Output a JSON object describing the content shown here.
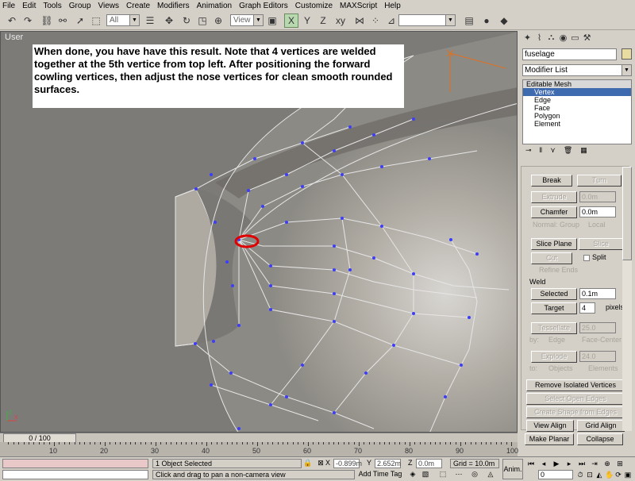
{
  "menu": [
    "File",
    "Edit",
    "Tools",
    "Group",
    "Views",
    "Create",
    "Modifiers",
    "Animation",
    "Graph Editors",
    "Customize",
    "MAXScript",
    "Help"
  ],
  "toolbar": {
    "selection_filter": "All",
    "ref_coord": "View",
    "named_selection": "",
    "icons": [
      "undo-icon",
      "redo-icon",
      "link-icon",
      "unlink-icon",
      "bind-space-warp-icon",
      "select-icon",
      "region-select-icon",
      "select-by-name-icon",
      "move-icon",
      "rotate-icon",
      "scale-icon",
      "mirror-icon",
      "snap-icon",
      "angle-snap-icon",
      "percent-snap-icon",
      "spinner-snap-icon",
      "align-icon",
      "render-icon",
      "material-editor-icon"
    ]
  },
  "viewport": {
    "label": "User",
    "note": "When done, you have have this result.  Note that 4 vertices are welded together at the 5th vertice from top left.  After positioning the forward cowling vertices, then adjust the nose vertices for clean smooth rounded surfaces.",
    "axis_labels": [
      "X",
      "Z"
    ]
  },
  "command_panel": {
    "object_name": "fuselage",
    "modifier_list": "Modifier List",
    "stack": [
      {
        "label": "Editable Mesh",
        "state": "top"
      },
      {
        "label": "Vertex",
        "state": "selected"
      },
      {
        "label": "Edge",
        "state": "normal"
      },
      {
        "label": "Face",
        "state": "normal"
      },
      {
        "label": "Polygon",
        "state": "normal"
      },
      {
        "label": "Element",
        "state": "normal"
      }
    ],
    "buttons": {
      "break": "Break",
      "turn": "Turn",
      "extrude": "Extrude",
      "extrude_val": "0.0m",
      "chamfer": "Chamfer",
      "chamfer_val": "0.0m",
      "normal_label": "Normal:",
      "group_label": "Group",
      "local_label": "Local",
      "slice_plane": "Slice Plane",
      "slice": "Slice",
      "cut": "Cut",
      "split": "Split",
      "refine_ends": "Refine Ends",
      "weld_title": "Weld",
      "selected": "Selected",
      "selected_val": "0.1m",
      "target": "Target",
      "target_val": "4",
      "pixels": "pixels",
      "tessellate": "Tessellate",
      "tess_val": "25.0",
      "by_label": "by:",
      "edge_label": "Edge",
      "face_center": "Face-Center",
      "explode": "Explode",
      "explode_val": "24.0",
      "to_label": "to:",
      "objects": "Objects",
      "elements": "Elements",
      "remove_isolated": "Remove Isolated Vertices",
      "select_open_edges": "Select Open Edges",
      "create_shape": "Create Shape from Edges",
      "view_align": "View Align",
      "grid_align": "Grid Align",
      "make_planar": "Make Planar",
      "collapse": "Collapse"
    }
  },
  "timeline": {
    "slider": "0 / 100",
    "ticks": [
      "10",
      "20",
      "30",
      "40",
      "50",
      "60",
      "70",
      "80",
      "90",
      "100"
    ]
  },
  "status": {
    "selection_info": "1 Object Selected",
    "prompt": "Click and drag to pan a non-camera view",
    "x_label": "X",
    "x": "-0.899m",
    "y_label": "Y",
    "y": "2.652m",
    "z_label": "Z",
    "z": "0.0m",
    "grid": "Grid = 10.0m",
    "add_time_tag": "Add Time Tag",
    "anim_key": "Anim.",
    "frame": "0"
  },
  "colors": {
    "vertex": "#3c3cff",
    "selection": "#3e6ab0",
    "highlight_circle": "#e00000",
    "object_color": "#e8dca0"
  }
}
